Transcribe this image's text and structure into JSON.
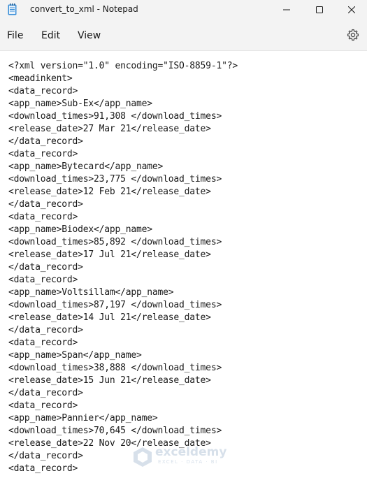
{
  "window": {
    "title": "convert_to_xml - Notepad",
    "icons": {
      "app": "notepad-icon",
      "minimize": "minimize-icon",
      "maximize": "maximize-icon",
      "close": "close-icon"
    }
  },
  "menu": {
    "file": "File",
    "edit": "Edit",
    "view": "View",
    "settings_icon": "gear-icon"
  },
  "editor": {
    "lines": [
      "<?xml version=\"1.0\" encoding=\"ISO-8859-1\"?>",
      "<meadinkent>",
      "<data_record>",
      "<app_name>Sub-Ex</app_name>",
      "<download_times>91,308 </download_times>",
      "<release_date>27 Mar 21</release_date>",
      "</data_record>",
      "<data_record>",
      "<app_name>Bytecard</app_name>",
      "<download_times>23,775 </download_times>",
      "<release_date>12 Feb 21</release_date>",
      "</data_record>",
      "<data_record>",
      "<app_name>Biodex</app_name>",
      "<download_times>85,892 </download_times>",
      "<release_date>17 Jul 21</release_date>",
      "</data_record>",
      "<data_record>",
      "<app_name>Voltsillam</app_name>",
      "<download_times>87,197 </download_times>",
      "<release_date>14 Jul 21</release_date>",
      "</data_record>",
      "<data_record>",
      "<app_name>Span</app_name>",
      "<download_times>38,888 </download_times>",
      "<release_date>15 Jun 21</release_date>",
      "</data_record>",
      "<data_record>",
      "<app_name>Pannier</app_name>",
      "<download_times>70,645 </download_times>",
      "<release_date>22 Nov 20</release_date>",
      "</data_record>",
      "<data_record>"
    ]
  },
  "watermark": {
    "name": "exceldemy",
    "tagline": "EXCEL · DATA · BI"
  }
}
